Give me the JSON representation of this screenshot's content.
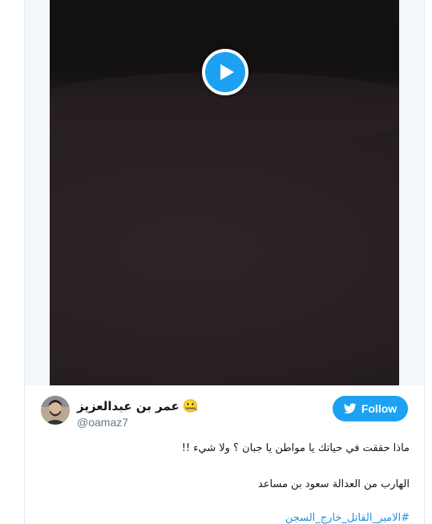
{
  "tweet": {
    "author": {
      "display_name": "عمر بن عبدالعزيز",
      "emoji": "🤐",
      "handle": "@oamaz7"
    },
    "follow_label": "Follow",
    "text_line1": "ماذا حققت في حياتك يا مواطن يا جبان ؟ ولا شيء !!",
    "text_line2": "الهارب من العدالة سعود بن مساعد",
    "hashtag": "#الامير_القاتل_خارج_السجن"
  },
  "colors": {
    "accent": "#1da1f2",
    "link": "#1b95e0",
    "handle_gray": "#657786"
  },
  "icons": {
    "play": "play-icon",
    "follow": "twitter-bird-icon",
    "avatar": "avatar"
  }
}
